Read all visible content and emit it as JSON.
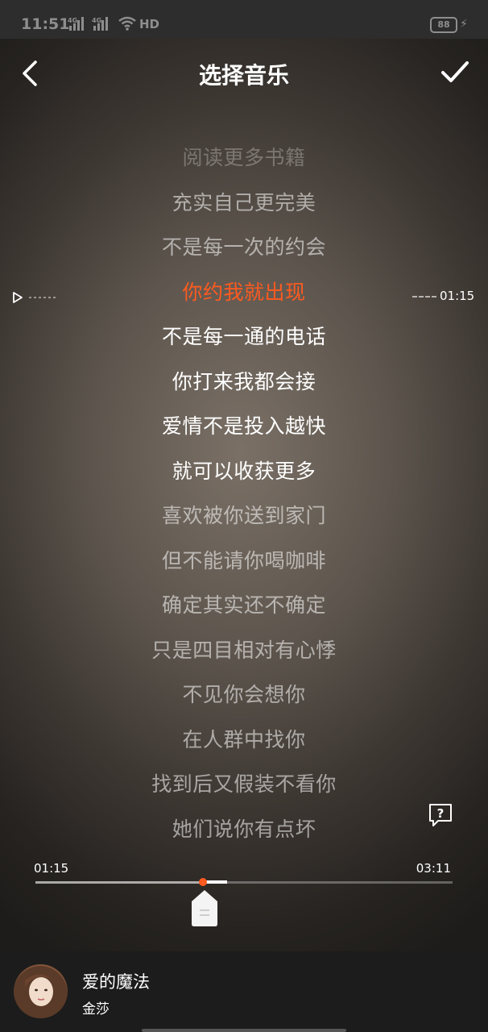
{
  "status_bar": {
    "time": "11:51",
    "network_1": "4G",
    "network_2": "4G",
    "network_label": "HD",
    "battery": "88"
  },
  "header": {
    "title": "选择音乐"
  },
  "lyrics": [
    {
      "text": "阅读更多书籍",
      "state": "faint"
    },
    {
      "text": "充实自己更完美",
      "state": "dim"
    },
    {
      "text": "不是每一次的约会",
      "state": "dim"
    },
    {
      "text": "你约我就出现",
      "state": "active"
    },
    {
      "text": "不是每一通的电话",
      "state": "bright"
    },
    {
      "text": "你打来我都会接",
      "state": "bright"
    },
    {
      "text": "爱情不是投入越快",
      "state": "bright"
    },
    {
      "text": "就可以收获更多",
      "state": "bright"
    },
    {
      "text": "喜欢被你送到家门",
      "state": "dim"
    },
    {
      "text": "但不能请你喝咖啡",
      "state": "dim"
    },
    {
      "text": "确定其实还不确定",
      "state": "dim"
    },
    {
      "text": "只是四目相对有心悸",
      "state": "dim"
    },
    {
      "text": "不见你会想你",
      "state": "dim"
    },
    {
      "text": "在人群中找你",
      "state": "dim"
    },
    {
      "text": "找到后又假装不看你",
      "state": "dim"
    },
    {
      "text": "她们说你有点坏",
      "state": "dim"
    }
  ],
  "line_marker": {
    "time": "01:15"
  },
  "progress": {
    "current_time": "01:15",
    "total_time": "03:11",
    "played_fraction": 0.402,
    "segment_end_fraction": 0.459
  },
  "now_playing": {
    "song": "爱的魔法",
    "artist": "金莎"
  },
  "colors": {
    "accent": "#ff5a1f",
    "bottom_bar": "#1c1c1c"
  }
}
